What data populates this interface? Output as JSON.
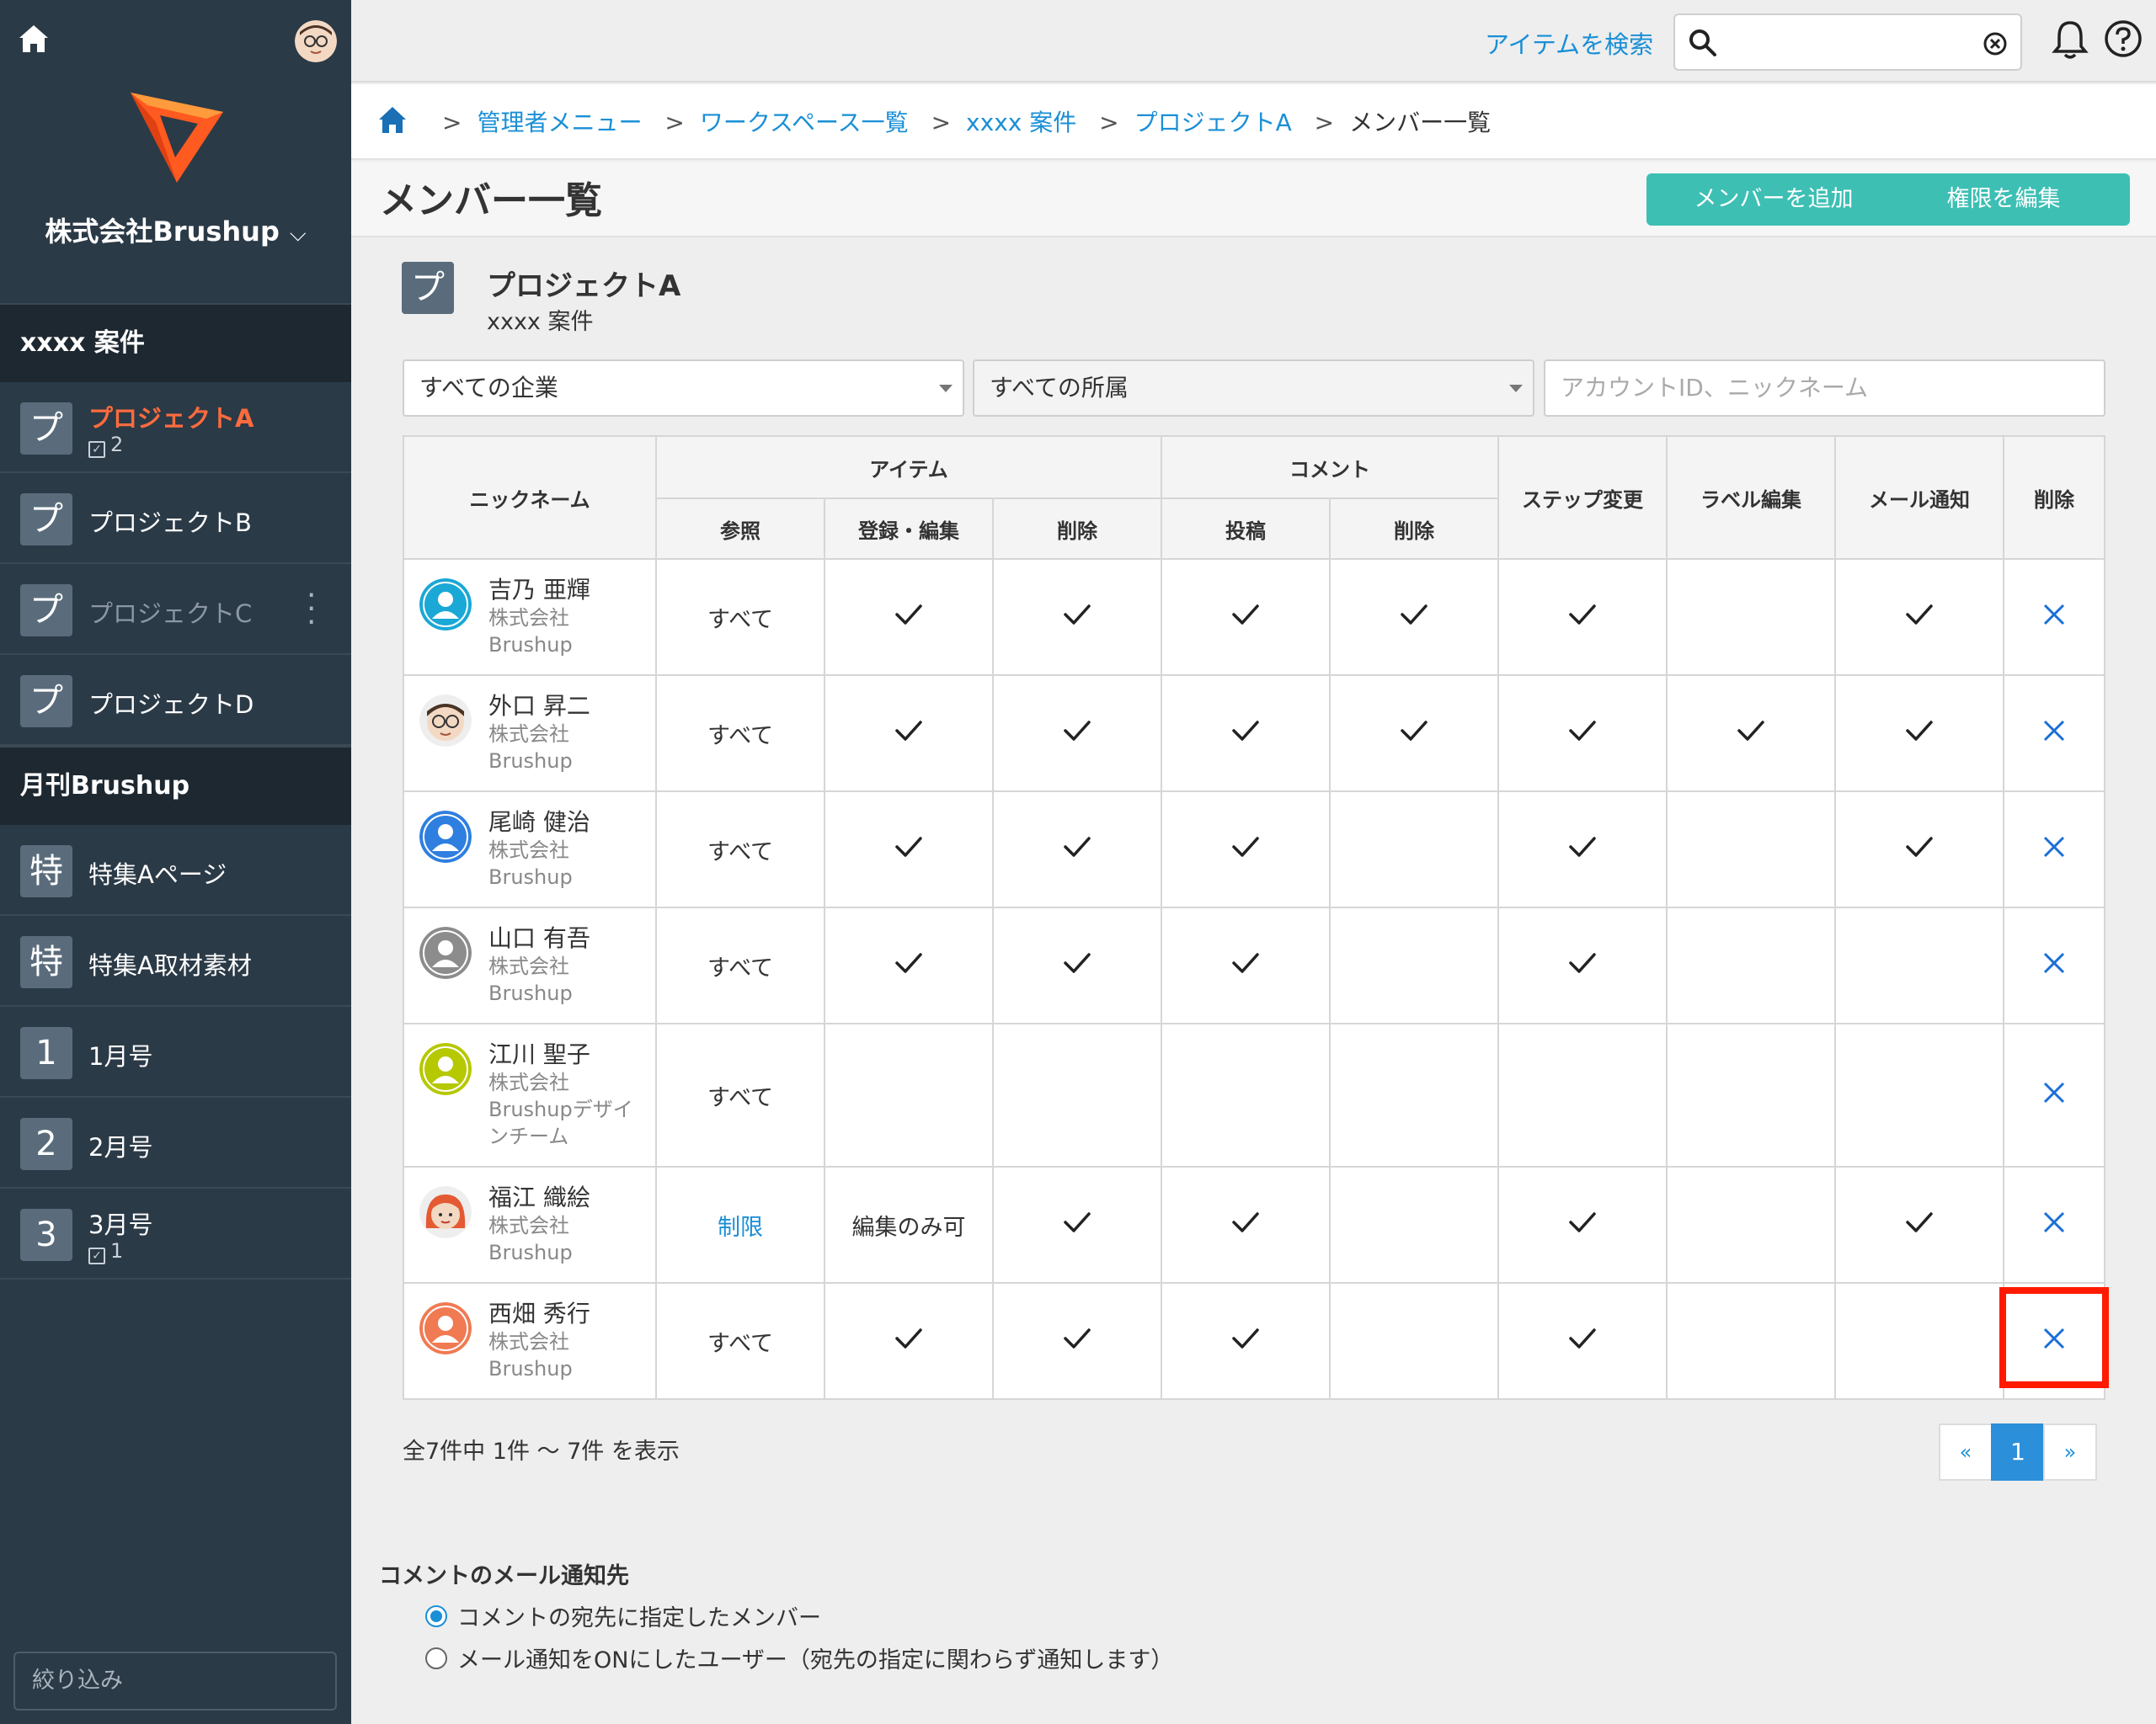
{
  "sidebar": {
    "company": "株式会社Brushup",
    "groups": [
      {
        "title": "xxxx 案件",
        "items": [
          {
            "badge": "プ",
            "label": "プロジェクトA",
            "count": "2",
            "state": "active"
          },
          {
            "badge": "プ",
            "label": "プロジェクトB"
          },
          {
            "badge": "プ",
            "label": "プロジェクトC",
            "state": "dim"
          },
          {
            "badge": "プ",
            "label": "プロジェクトD"
          }
        ]
      },
      {
        "title": "月刊Brushup",
        "items": [
          {
            "badge": "特",
            "label": "特集Aページ"
          },
          {
            "badge": "特",
            "label": "特集A取材素材"
          },
          {
            "badge": "1",
            "label": "1月号"
          },
          {
            "badge": "2",
            "label": "2月号"
          },
          {
            "badge": "3",
            "label": "3月号",
            "count": "1"
          }
        ]
      }
    ],
    "filter_placeholder": "絞り込み"
  },
  "topbar": {
    "search_link": "アイテムを検索",
    "search_value": ""
  },
  "breadcrumb": {
    "items": [
      "管理者メニュー",
      "ワークスペース一覧",
      "xxxx 案件",
      "プロジェクトA"
    ],
    "current": "メンバー一覧"
  },
  "page": {
    "title": "メンバー一覧",
    "add_member": "メンバーを追加",
    "edit_permission": "権限を編集"
  },
  "project": {
    "badge": "プ",
    "name": "プロジェクトA",
    "workspace": "xxxx 案件"
  },
  "filters": {
    "company": "すべての企業",
    "affiliation": "すべての所属",
    "search_placeholder": "アカウントID、ニックネーム"
  },
  "table": {
    "headers": {
      "nickname": "ニックネーム",
      "item": "アイテム",
      "comment": "コメント",
      "step": "ステップ変更",
      "label": "ラベル編集",
      "mail": "メール通知",
      "delete": "削除",
      "ref": "参照",
      "edit": "登録・編集",
      "item_delete": "削除",
      "post": "投稿",
      "comment_delete": "削除"
    },
    "rows": [
      {
        "name": "吉乃 亜輝",
        "company": [
          "株式会社",
          "Brushup"
        ],
        "avatar": "cyan",
        "ref": "すべて",
        "edit": true,
        "item_delete": true,
        "post": true,
        "comment_delete": true,
        "step": true,
        "label": false,
        "mail": true
      },
      {
        "name": "外口 昇二",
        "company": [
          "株式会社",
          "Brushup"
        ],
        "avatar": "face",
        "ref": "すべて",
        "edit": true,
        "item_delete": true,
        "post": true,
        "comment_delete": true,
        "step": true,
        "label": true,
        "mail": true
      },
      {
        "name": "尾崎 健治",
        "company": [
          "株式会社",
          "Brushup"
        ],
        "avatar": "blue",
        "ref": "すべて",
        "edit": true,
        "item_delete": true,
        "post": true,
        "comment_delete": false,
        "step": true,
        "label": false,
        "mail": true
      },
      {
        "name": "山口 有吾",
        "company": [
          "株式会社",
          "Brushup"
        ],
        "avatar": "gray",
        "ref": "すべて",
        "edit": true,
        "item_delete": true,
        "post": true,
        "comment_delete": false,
        "step": true,
        "label": false,
        "mail": false
      },
      {
        "name": "江川 聖子",
        "company": [
          "株式会社",
          "Brushupデザイ",
          "ンチーム"
        ],
        "avatar": "lime",
        "ref": "すべて",
        "edit": false,
        "item_delete": false,
        "post": false,
        "comment_delete": false,
        "step": false,
        "label": false,
        "mail": false
      },
      {
        "name": "福江 織絵",
        "company": [
          "株式会社",
          "Brushup"
        ],
        "avatar": "woman",
        "ref": "制限",
        "ref_limited": true,
        "edit_text": "編集のみ可",
        "item_delete": true,
        "post": true,
        "comment_delete": false,
        "step": true,
        "label": false,
        "mail": true
      },
      {
        "name": "西畑 秀行",
        "company": [
          "株式会社",
          "Brushup"
        ],
        "avatar": "orange",
        "ref": "すべて",
        "edit": true,
        "item_delete": true,
        "post": true,
        "comment_delete": false,
        "step": true,
        "label": false,
        "mail": false,
        "highlight": true
      }
    ]
  },
  "pagination": {
    "summary": "全7件中 1件 〜 7件 を表示",
    "prev": "«",
    "current": "1",
    "next": "»"
  },
  "notify": {
    "title": "コメントのメール通知先",
    "options": [
      "コメントの宛先に指定したメンバー",
      "メール通知をONにしたユーザー（宛先の指定に関わらず通知します）"
    ],
    "selected": 0
  },
  "colors": {
    "sidebar": "#2b3a47",
    "accent": "#3dbfb4",
    "link": "#1a8fd6",
    "active": "#ff6b3d",
    "highlight": "#ff1a00"
  }
}
